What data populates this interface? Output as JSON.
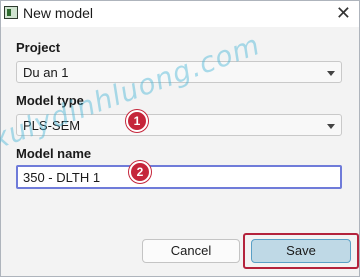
{
  "window": {
    "title": "New model",
    "close_glyph": "✕"
  },
  "project": {
    "label": "Project",
    "value": "Du an 1"
  },
  "model_type": {
    "label": "Model type",
    "value": "PLS-SEM"
  },
  "model_name": {
    "label": "Model name",
    "value": "350 - DLTH 1"
  },
  "annotations": {
    "badge1": "1",
    "badge2": "2",
    "highlight_color": "#b4233c"
  },
  "watermark": {
    "text": "xulydinhluong.com"
  },
  "buttons": {
    "cancel": "Cancel",
    "save": "Save"
  },
  "colors": {
    "badge": "#c5253a",
    "save_bg": "#bfd9e6",
    "input_border": "#6f7bd9"
  }
}
